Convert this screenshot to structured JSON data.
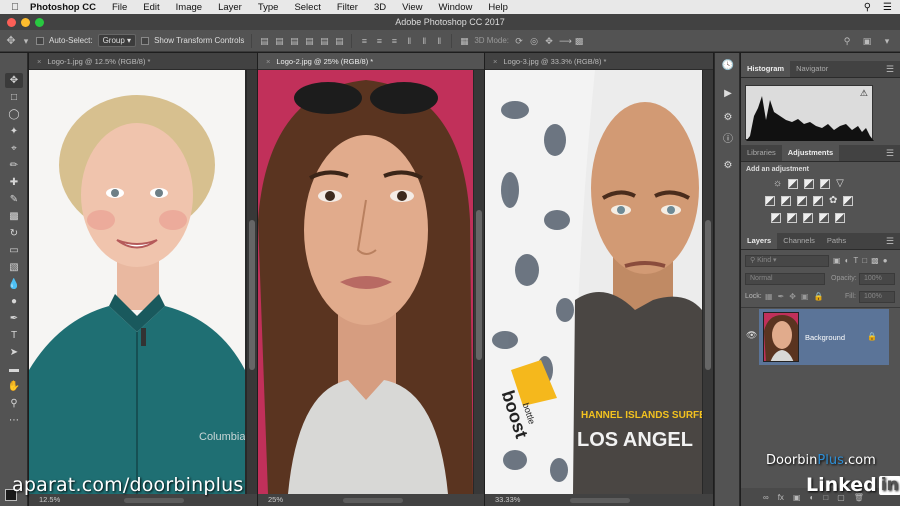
{
  "menubar": {
    "app_name": "Photoshop CC",
    "items": [
      "File",
      "Edit",
      "Image",
      "Layer",
      "Type",
      "Select",
      "Filter",
      "3D",
      "View",
      "Window",
      "Help"
    ]
  },
  "window": {
    "title": "Adobe Photoshop CC 2017"
  },
  "options_bar": {
    "auto_select_label": "Auto-Select:",
    "auto_select_value": "Group",
    "transform_label": "Show Transform Controls",
    "mode_label": "3D Mode:"
  },
  "documents": [
    {
      "tab": "Logo-1.jpg @ 12.5% (RGB/8) *",
      "zoom": "12.5%",
      "active": false
    },
    {
      "tab": "Logo-2.jpg @ 25% (RGB/8) *",
      "zoom": "25%",
      "active": true
    },
    {
      "tab": "Logo-3.jpg @ 33.3% (RGB/8) *",
      "zoom": "33.33%",
      "active": false
    }
  ],
  "doc_art": {
    "board_logo": "boost",
    "board_sub": "bottle",
    "shirt_line1": "HANNEL ISLANDS SURFB",
    "shirt_line2": "LOS ANGEL",
    "fleece_logo": "Columbia"
  },
  "panels": {
    "top_tabs": [
      "Histogram",
      "Navigator"
    ],
    "mid_tabs": [
      "Libraries",
      "Adjustments"
    ],
    "add_adjustment": "Add an adjustment",
    "layers_tabs": [
      "Layers",
      "Channels",
      "Paths"
    ],
    "kind_placeholder": "Kind",
    "blend_mode": "Normal",
    "opacity_label": "Opacity:",
    "opacity_value": "100%",
    "lock_label": "Lock:",
    "fill_label": "Fill:",
    "fill_value": "100%",
    "layer_name": "Background",
    "bottom_fx": "fx"
  },
  "watermarks": {
    "aparat": "aparat.com/doorbinplus",
    "doorbin_main": "Doorbin",
    "doorbin_plus": "Plus",
    "doorbin_tld": ".com",
    "linkedin_text": "Linked",
    "linkedin_in": "in"
  },
  "colors": {
    "menubar": "#e8e8e8",
    "chrome": "#535353",
    "chrome_dark": "#424242",
    "layer_selected": "#5b7498",
    "accent_plus": "#2e8fd6"
  }
}
